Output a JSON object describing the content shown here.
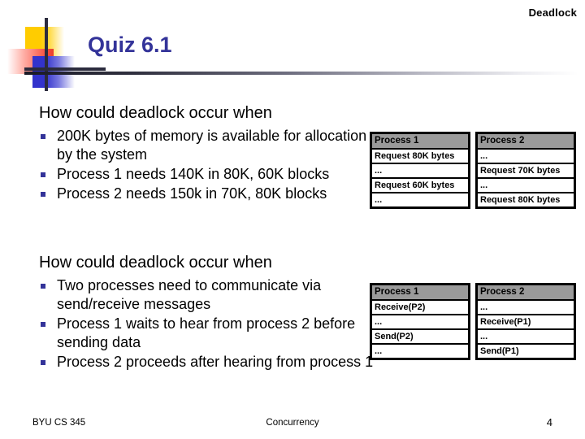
{
  "header": {
    "topic_label": "Deadlock"
  },
  "title": {
    "text": "Quiz 6.1",
    "color": "#333399"
  },
  "logo": {
    "yellow": "#ffcc00",
    "red": "#f74d3c",
    "blue": "#3333cc",
    "cross": "#2b2b3d"
  },
  "sections": [
    {
      "lead": "How could deadlock occur when",
      "bullets": [
        "200K bytes of memory is available for allocation by the system",
        "Process 1 needs 140K in 80K, 60K blocks",
        "Process 2 needs 150k in 70K, 80K blocks"
      ],
      "tables": [
        {
          "header": "Process 1",
          "rows": [
            "Request 80K bytes",
            "...",
            "Request 60K bytes",
            "..."
          ]
        },
        {
          "header": "Process 2",
          "rows": [
            "...",
            "Request 70K bytes",
            "...",
            "Request 80K bytes"
          ]
        }
      ]
    },
    {
      "lead": "How could deadlock occur when",
      "bullets": [
        "Two processes need to communicate via send/receive messages",
        "Process 1 waits to hear from process 2 before sending data",
        "Process 2 proceeds after hearing from process 1"
      ],
      "tables": [
        {
          "header": "Process 1",
          "rows": [
            "Receive(P2)",
            "...",
            "Send(P2)",
            "..."
          ]
        },
        {
          "header": "Process 2",
          "rows": [
            "...",
            "Receive(P1)",
            "...",
            "Send(P1)"
          ]
        }
      ]
    }
  ],
  "footer": {
    "left": "BYU CS 345",
    "center": "Concurrency",
    "page": "4"
  }
}
